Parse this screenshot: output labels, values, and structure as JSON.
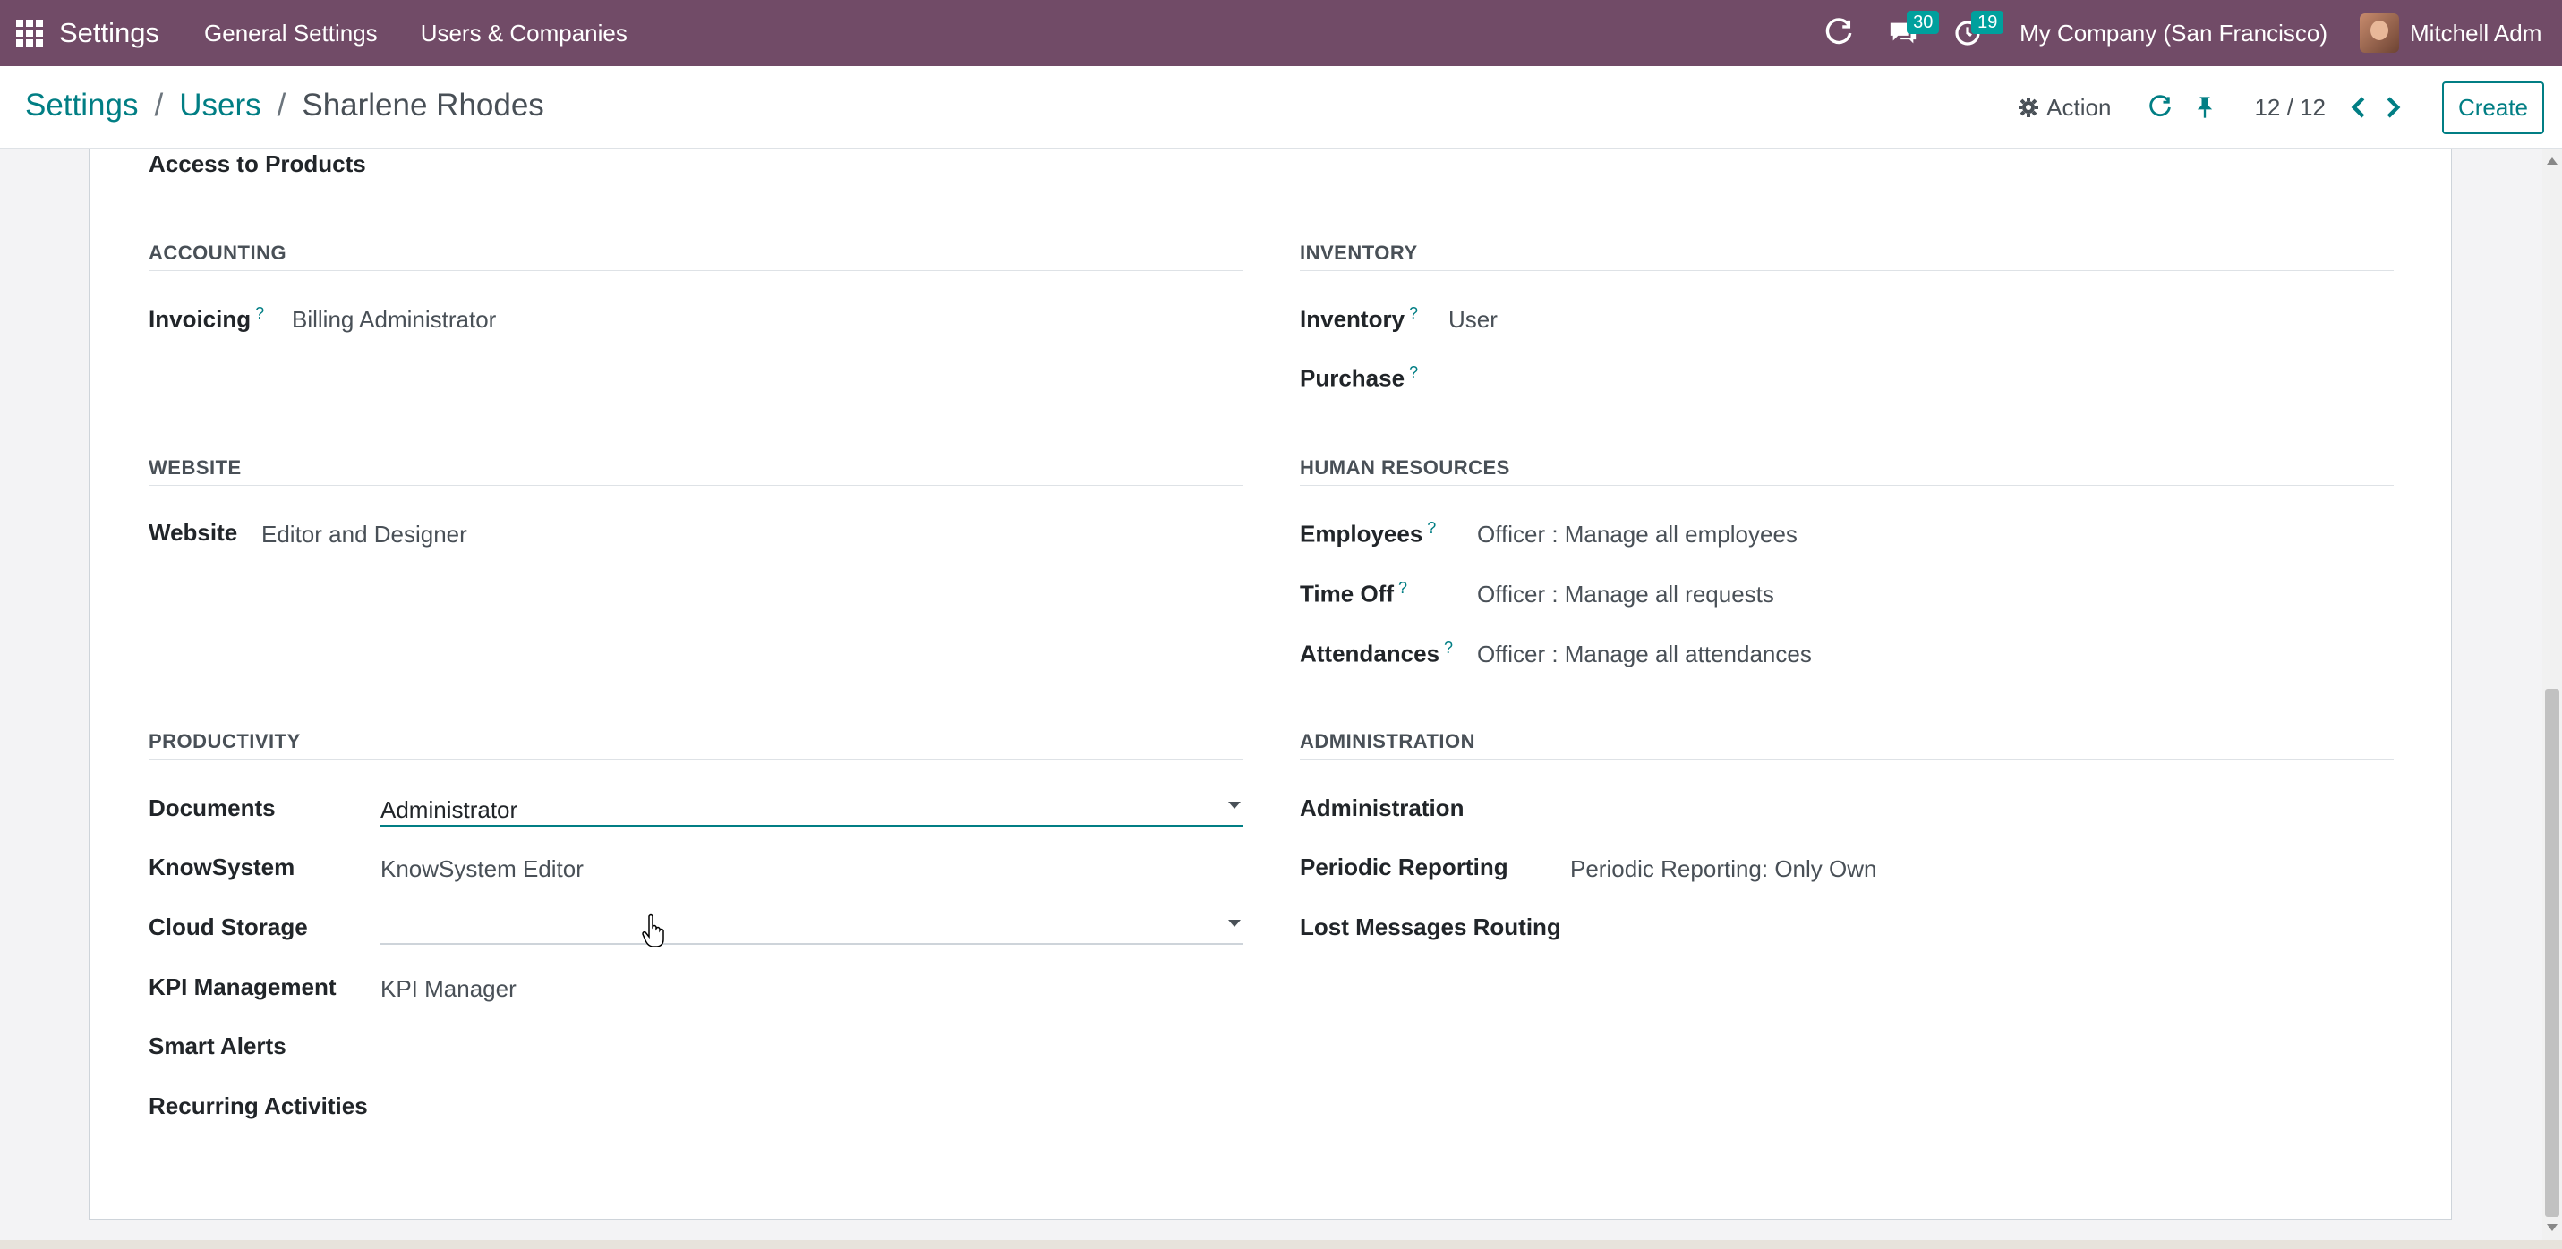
{
  "navbar": {
    "brand": "Settings",
    "menus": [
      "General Settings",
      "Users & Companies"
    ],
    "messages_count": "30",
    "activities_count": "19",
    "company": "My Company (San Francisco)",
    "user": "Mitchell Adm"
  },
  "control_panel": {
    "breadcrumbs": [
      "Settings",
      "Users",
      "Sharlene Rhodes"
    ],
    "action_label": "Action",
    "pager": "12 / 12",
    "create_label": "Create"
  },
  "form": {
    "top_label": "Access to Products",
    "accounting": {
      "title": "ACCOUNTING",
      "fields": [
        {
          "label": "Invoicing",
          "help": "?",
          "value": "Billing Administrator"
        }
      ]
    },
    "inventory": {
      "title": "INVENTORY",
      "fields": [
        {
          "label": "Inventory",
          "help": "?",
          "value": "User"
        },
        {
          "label": "Purchase",
          "help": "?",
          "value": ""
        }
      ]
    },
    "website": {
      "title": "WEBSITE",
      "fields": [
        {
          "label": "Website",
          "value": "Editor and Designer"
        }
      ]
    },
    "human_resources": {
      "title": "HUMAN RESOURCES",
      "fields": [
        {
          "label": "Employees",
          "help": "?",
          "value": "Officer : Manage all employees"
        },
        {
          "label": "Time Off",
          "help": "?",
          "value": "Officer : Manage all requests"
        },
        {
          "label": "Attendances",
          "help": "?",
          "value": "Officer : Manage all attendances"
        }
      ]
    },
    "productivity": {
      "title": "PRODUCTIVITY",
      "fields": [
        {
          "label": "Documents",
          "value": "Administrator"
        },
        {
          "label": "KnowSystem",
          "value": "KnowSystem Editor"
        },
        {
          "label": "Cloud Storage",
          "value": ""
        },
        {
          "label": "KPI Management",
          "value": "KPI Manager"
        },
        {
          "label": "Smart Alerts",
          "value": ""
        },
        {
          "label": "Recurring Activities",
          "value": ""
        }
      ]
    },
    "administration": {
      "title": "ADMINISTRATION",
      "fields": [
        {
          "label": "Administration",
          "value": ""
        },
        {
          "label": "Periodic Reporting",
          "value": "Periodic Reporting: Only Own"
        },
        {
          "label": "Lost Messages Routing",
          "value": ""
        }
      ]
    }
  },
  "colors": {
    "navbar": "#714b67",
    "accent": "#017e84",
    "badge": "#00a09d"
  }
}
